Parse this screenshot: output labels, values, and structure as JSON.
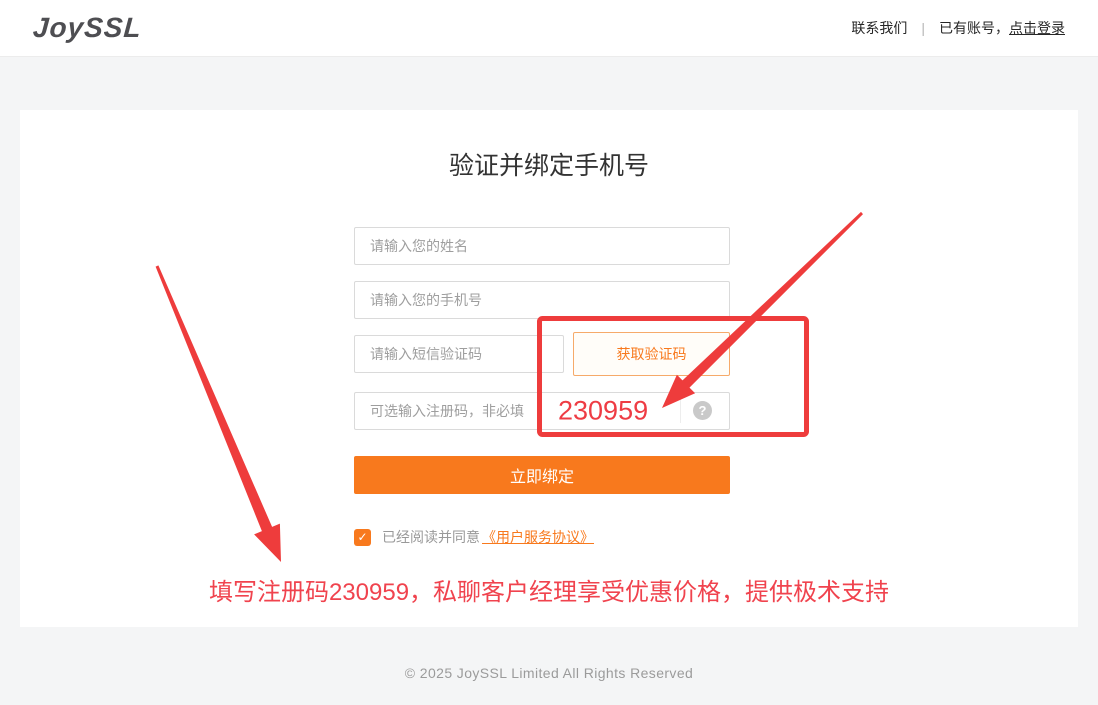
{
  "header": {
    "logo": "JoySSL",
    "contact": "联系我们",
    "divider": "|",
    "have_account": "已有账号，",
    "login_link": "点击登录"
  },
  "form": {
    "title": "验证并绑定手机号",
    "name_placeholder": "请输入您的姓名",
    "phone_placeholder": "请输入您的手机号",
    "sms_placeholder": "请输入短信验证码",
    "get_code_button": "获取验证码",
    "regcode_placeholder": "可选输入注册码，非必填",
    "help_icon": "?",
    "bind_button": "立即绑定",
    "check_glyph": "✓",
    "agree_text": "已经阅读并同意",
    "agreement_link": "《用户服务协议》"
  },
  "annotations": {
    "reg_code_value": "230959",
    "promo_text": "填写注册码230959，私聊客户经理享受优惠价格，提供极术支持"
  },
  "footer": {
    "copyright": "© 2025 JoySSL Limited All Rights Reserved"
  },
  "colors": {
    "accent_orange": "#f8791d",
    "annotation_red": "#ee3c3c",
    "promo_red": "#f0434e"
  }
}
